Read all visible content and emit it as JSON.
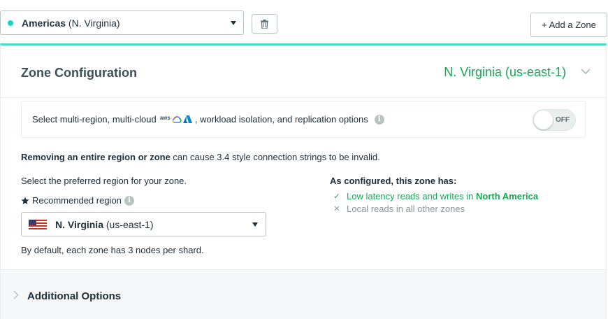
{
  "top_bar": {
    "zone_select": {
      "region_bold": "Americas",
      "region_detail": " (N. Virginia)",
      "dot_color": "#13d9c3"
    },
    "delete_icon": "trash-icon",
    "add_zone_label": "+ Add a Zone"
  },
  "panel": {
    "title": "Zone Configuration",
    "selected_region": "N. Virginia (us-east-1)",
    "accent_color": "#3ee0cf",
    "options": {
      "text_before": "Select multi-region, multi-cloud",
      "cloud_aws": "aws",
      "text_after": ", workload isolation, and replication options",
      "toggle_label": "OFF"
    },
    "warning_bold": "Removing an entire region or zone",
    "warning_rest": " can cause 3.4 style connection strings to be invalid.",
    "preferred_label": "Select the preferred region for your zone.",
    "recommended_label": "Recommended region",
    "region_select": {
      "name_bold": "N. Virginia",
      "name_detail": " (us-east-1)"
    },
    "default_note": "By default, each zone has 3 nodes per shard.",
    "configured": {
      "title": "As configured, this zone has:",
      "good_text": "Low latency reads and writes in ",
      "good_highlight": "North America",
      "neutral_text": "Local reads in all other zones"
    },
    "additional_options": "Additional Options"
  }
}
